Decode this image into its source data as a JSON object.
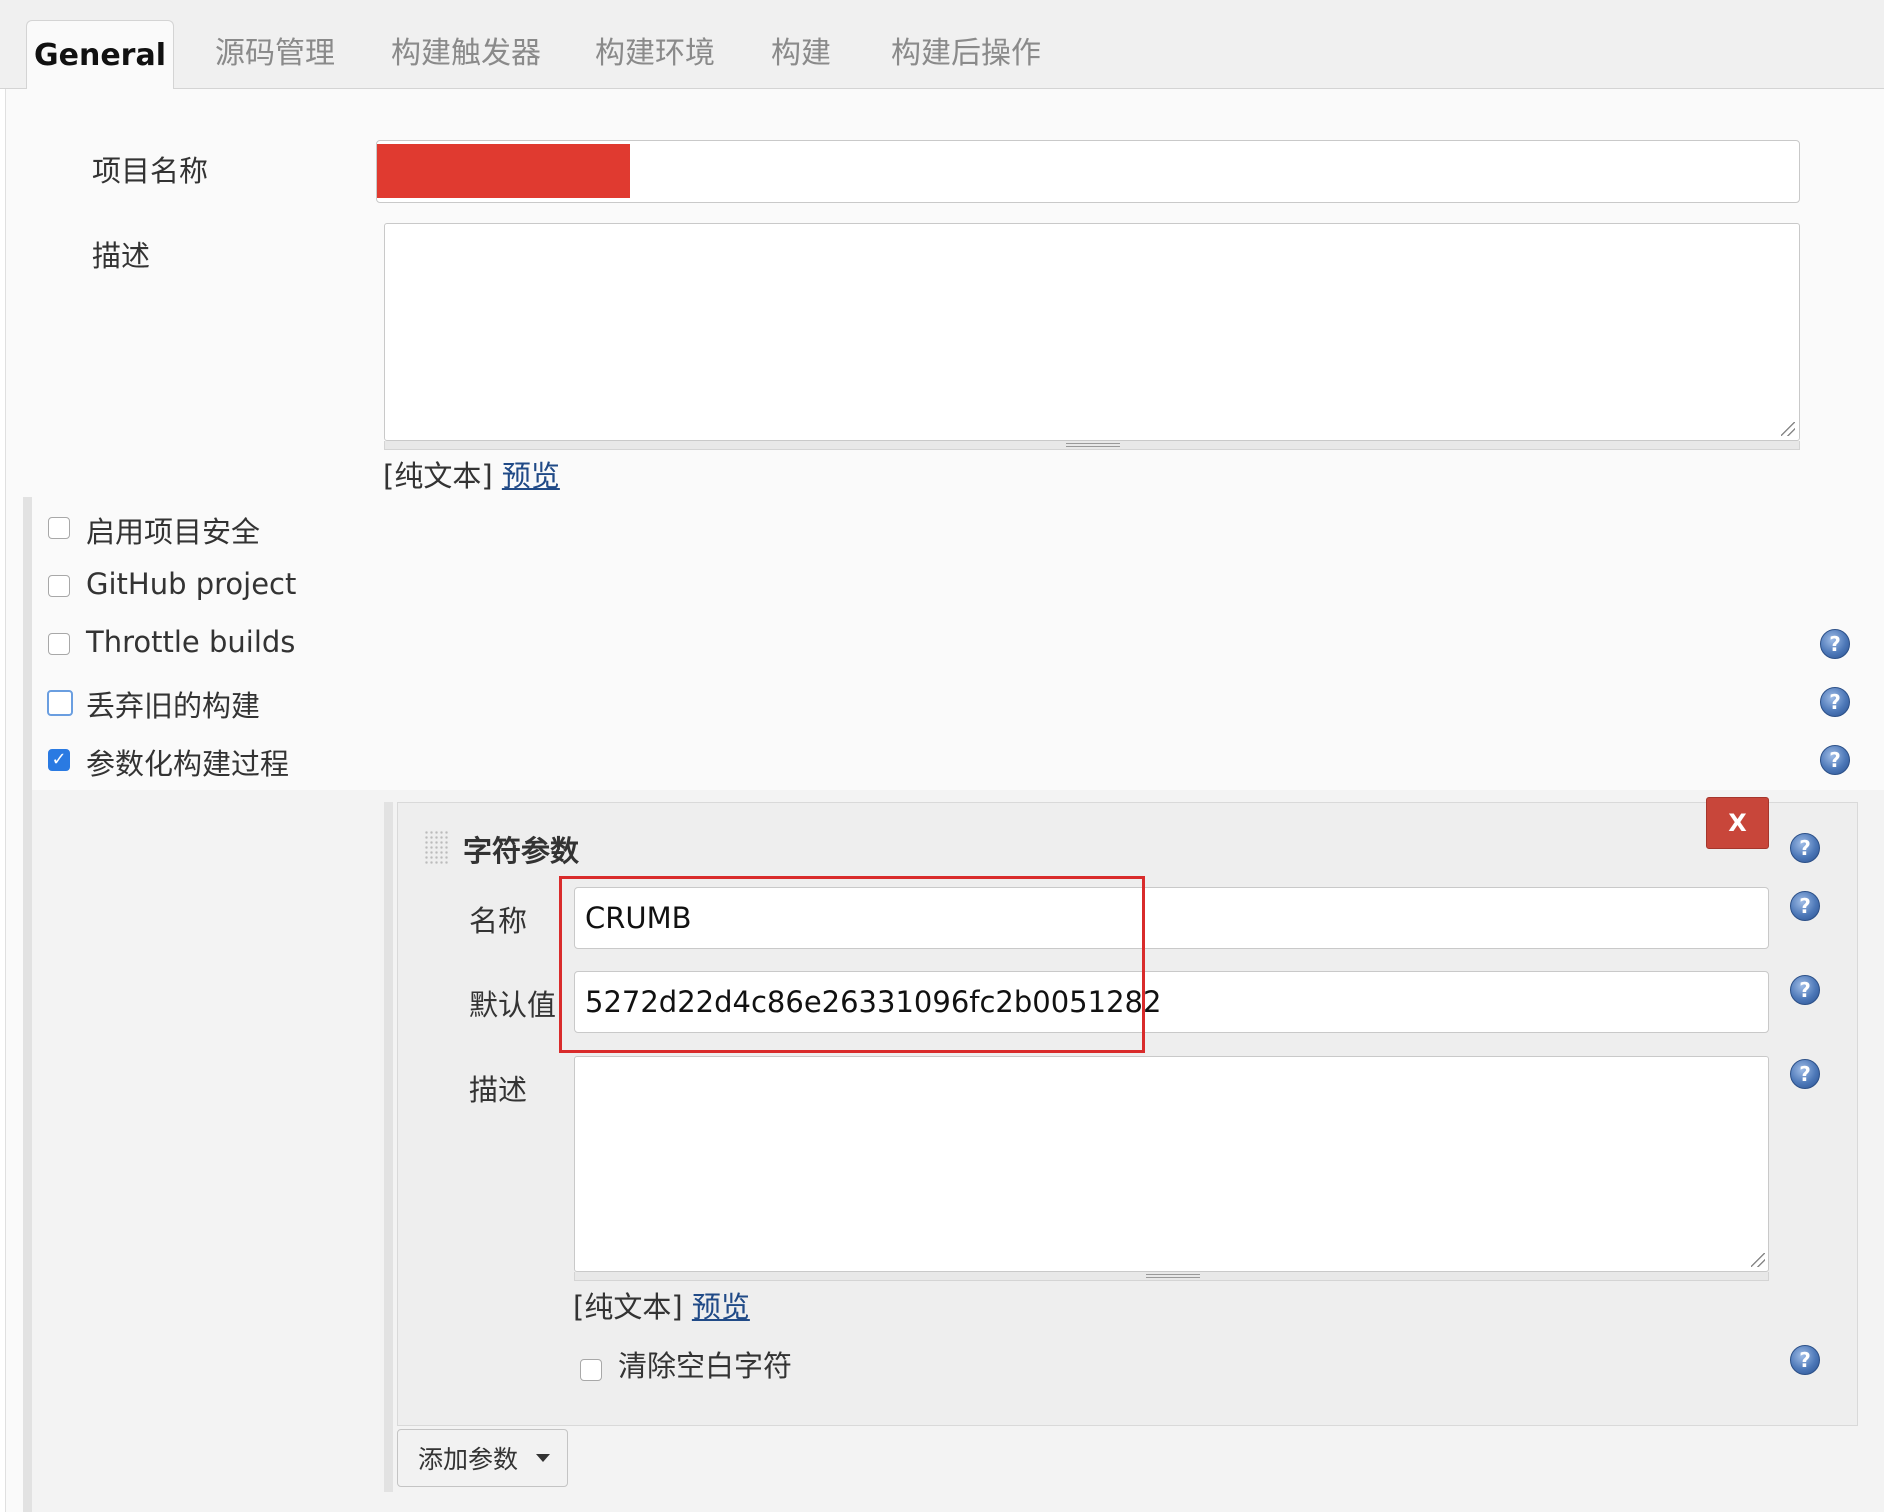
{
  "tabs": [
    {
      "label": "General",
      "active": true
    },
    {
      "label": "源码管理"
    },
    {
      "label": "构建触发器"
    },
    {
      "label": "构建环境"
    },
    {
      "label": "构建"
    },
    {
      "label": "构建后操作"
    }
  ],
  "project": {
    "name_label": "项目名称",
    "name_value": "",
    "description_label": "描述",
    "description_value": "",
    "format_text": "[纯文本]",
    "preview_link": "预览"
  },
  "options": [
    {
      "label": "启用项目安全",
      "checked": false
    },
    {
      "label": "GitHub project",
      "checked": false
    },
    {
      "label": "Throttle builds",
      "checked": false
    },
    {
      "label": "丢弃旧的构建",
      "checked": false
    },
    {
      "label": "参数化构建过程",
      "checked": true
    }
  ],
  "string_param": {
    "title": "字符参数",
    "delete_label": "X",
    "name_label": "名称",
    "name_value": "CRUMB",
    "default_label": "默认值",
    "default_value": "5272d22d4c86e26331096fc2b0051282",
    "description_label": "描述",
    "description_value": "",
    "format_text": "[纯文本]",
    "preview_link": "预览",
    "trim_label": "清除空白字符",
    "trim_checked": false
  },
  "add_param_label": "添加参数",
  "colors": {
    "redaction": "#e03a30",
    "highlight_box": "#d92b2b",
    "delete_button": "#c8463a",
    "checkbox_checked": "#2a7ae2",
    "link": "#204a87"
  },
  "icons": {
    "help": "help-icon",
    "checkmark": "check-icon",
    "drag": "drag-handle-icon",
    "dropdown": "caret-down-icon"
  }
}
